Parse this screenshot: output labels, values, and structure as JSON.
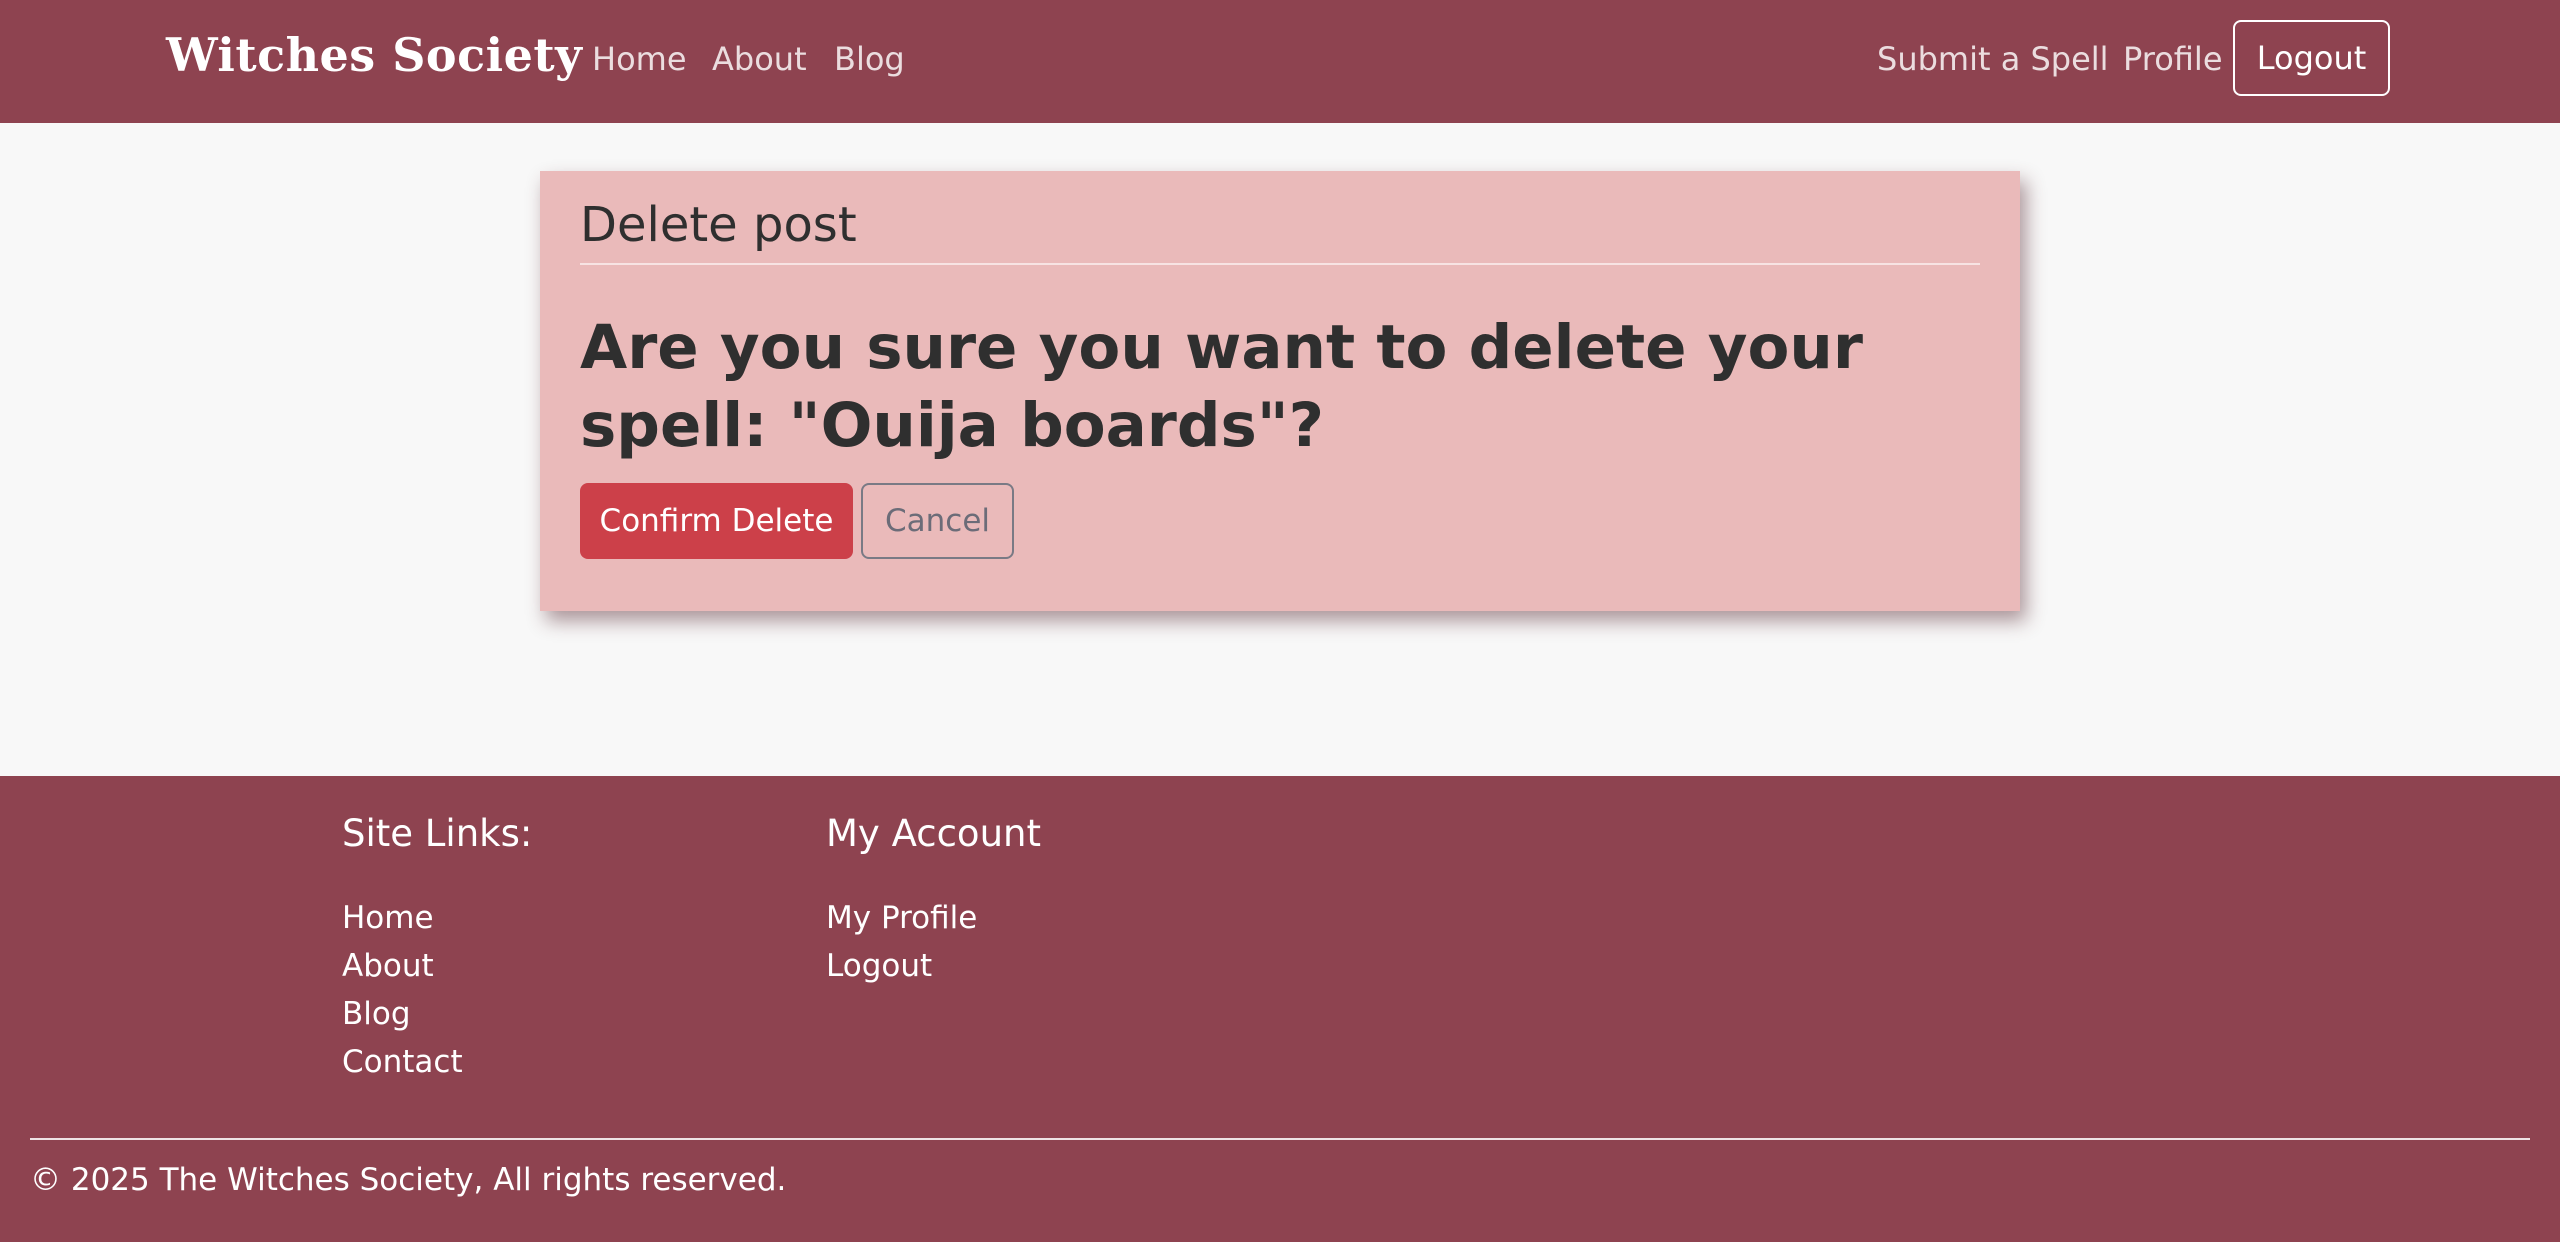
{
  "navbar": {
    "brand": "Witches Society",
    "links": [
      "Home",
      "About",
      "Blog"
    ],
    "right_links": [
      "Submit a Spell",
      "Profile"
    ],
    "logout_label": "Logout"
  },
  "delete_card": {
    "title": "Delete post",
    "question": "Are you sure you want to delete your spell: \"Ouija boards\"?",
    "confirm_label": "Confirm Delete",
    "cancel_label": "Cancel"
  },
  "footer": {
    "site_links_heading": "Site Links:",
    "site_links": [
      "Home",
      "About",
      "Blog",
      "Contact"
    ],
    "account_heading": "My Account",
    "account_links": [
      "My Profile",
      "Logout"
    ],
    "copyright": "© 2025 The Witches Society, All rights reserved."
  },
  "colors": {
    "brand_maroon": "#8e4350",
    "card_pink": "#eababa",
    "danger_red": "#cc4049"
  }
}
